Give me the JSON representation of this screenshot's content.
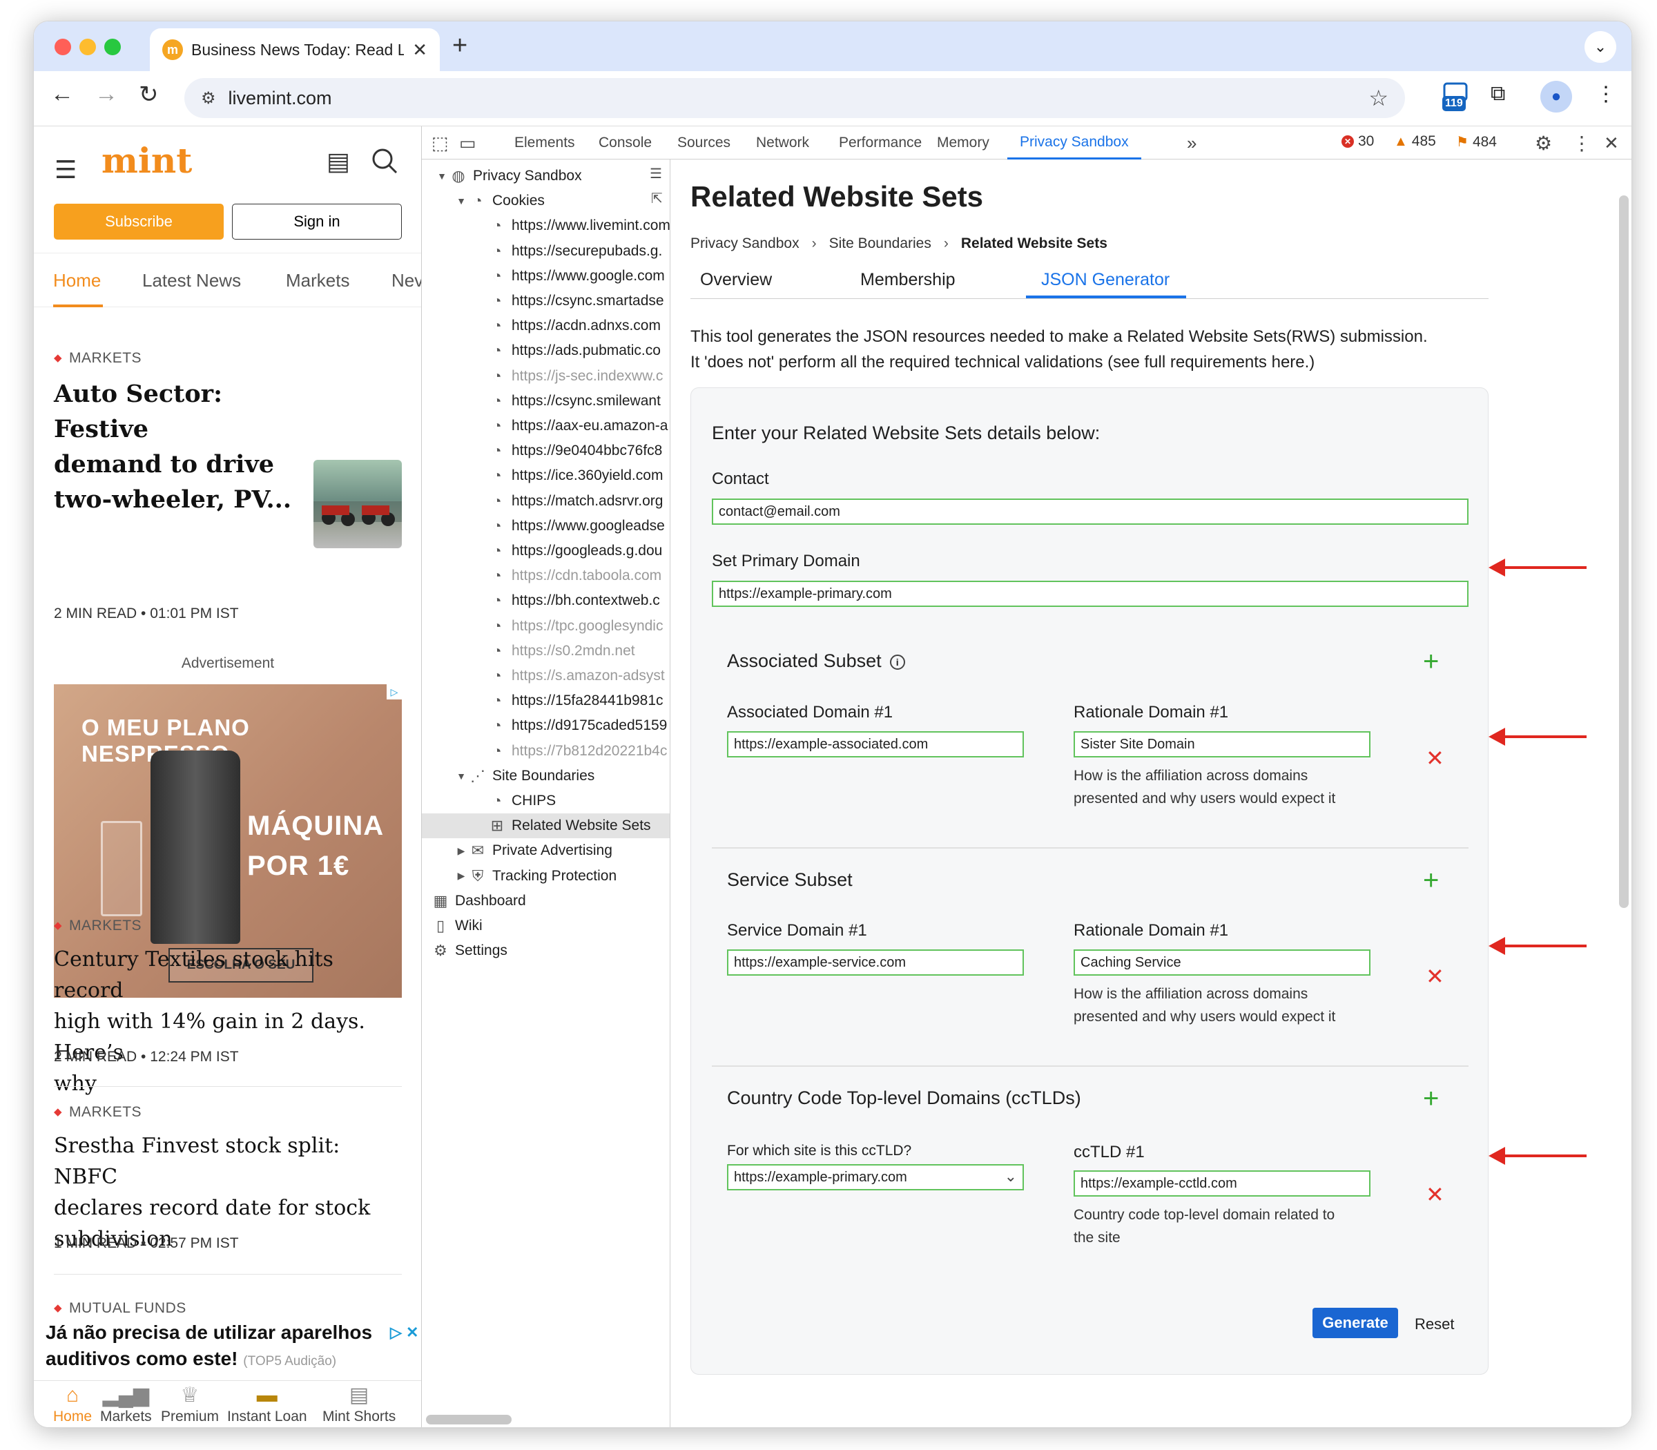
{
  "browser": {
    "tab_title": "Business News Today: Read L",
    "favicon_letter": "m",
    "url": "livemint.com",
    "extension_badge": "119"
  },
  "mint": {
    "logo": "mint",
    "subscribe": "Subscribe",
    "sign_in": "Sign in",
    "nav": [
      "Home",
      "Latest News",
      "Markets",
      "Nev"
    ],
    "articles": [
      {
        "section": "MARKETS",
        "headline_lines": [
          "Auto Sector: Festive",
          "demand to drive",
          "two-wheeler, PV..."
        ],
        "meta": "2 MIN READ • 01:01 PM IST"
      },
      {
        "section": "MARKETS",
        "headline_lines": [
          "Century Textiles stock hits record",
          "high with 14% gain in 2 days. Here’s",
          "why"
        ],
        "meta": "2 MIN READ • 12:24 PM IST"
      },
      {
        "section": "MARKETS",
        "headline_lines": [
          "Srestha Finvest stock split: NBFC",
          "declares record date for stock",
          "subdivision"
        ],
        "meta": "1 MIN READ • 02:57 PM IST"
      },
      {
        "section": "MUTUAL FUNDS"
      }
    ],
    "advertisement_label": "Advertisement",
    "ad": {
      "headline": "O MEU PLANO NESPRESSO",
      "offer_line1": "MÁQUINA",
      "offer_line2": "POR 1€",
      "cta": "ESCOLHA O SEU"
    },
    "banner": {
      "line1": "Já não precisa de utilizar aparelhos",
      "line2": "auditivos como este!",
      "source": "(TOP5 Audição)"
    },
    "bottom_nav": [
      "Home",
      "Markets",
      "Premium",
      "Instant Loan",
      "Mint Shorts"
    ]
  },
  "devtools": {
    "tabs": [
      "Elements",
      "Console",
      "Sources",
      "Network",
      "Performance",
      "Memory",
      "Privacy Sandbox"
    ],
    "active_tab": "Privacy Sandbox",
    "counts": {
      "errors": "30",
      "warnings": "485",
      "issues": "484"
    },
    "tree": {
      "root": "Privacy Sandbox",
      "cookies": "Cookies",
      "cookie_items": [
        {
          "url": "https://www.livemint.com",
          "dim": false
        },
        {
          "url": "https://securepubads.g.",
          "dim": false
        },
        {
          "url": "https://www.google.com",
          "dim": false
        },
        {
          "url": "https://csync.smartadse",
          "dim": false
        },
        {
          "url": "https://acdn.adnxs.com",
          "dim": false
        },
        {
          "url": "https://ads.pubmatic.co",
          "dim": false
        },
        {
          "url": "https://js-sec.indexww.c",
          "dim": true
        },
        {
          "url": "https://csync.smilewant",
          "dim": false
        },
        {
          "url": "https://aax-eu.amazon-a",
          "dim": false
        },
        {
          "url": "https://9e0404bbc76fc8",
          "dim": false
        },
        {
          "url": "https://ice.360yield.com",
          "dim": false
        },
        {
          "url": "https://match.adsrvr.org",
          "dim": false
        },
        {
          "url": "https://www.googleadse",
          "dim": false
        },
        {
          "url": "https://googleads.g.dou",
          "dim": false
        },
        {
          "url": "https://cdn.taboola.com",
          "dim": true
        },
        {
          "url": "https://bh.contextweb.c",
          "dim": false
        },
        {
          "url": "https://tpc.googlesyndic",
          "dim": true
        },
        {
          "url": "https://s0.2mdn.net",
          "dim": true
        },
        {
          "url": "https://s.amazon-adsyst",
          "dim": true
        },
        {
          "url": "https://15fa28441b981c",
          "dim": false
        },
        {
          "url": "https://d9175caded5159",
          "dim": false
        },
        {
          "url": "https://7b812d20221b4c",
          "dim": true
        }
      ],
      "site_boundaries": "Site Boundaries",
      "chips": "CHIPS",
      "rws": "Related Website Sets",
      "private_advertising": "Private Advertising",
      "tracking_protection": "Tracking Protection",
      "dashboard": "Dashboard",
      "wiki": "Wiki",
      "settings": "Settings"
    },
    "panel": {
      "title": "Related Website Sets",
      "breadcrumb": [
        "Privacy Sandbox",
        "Site Boundaries",
        "Related Website Sets"
      ],
      "tabs": [
        "Overview",
        "Membership",
        "JSON Generator"
      ],
      "active_tab": "JSON Generator",
      "description_line1": "This tool generates the JSON resources needed to make a Related Website Sets(RWS) submission.",
      "description_line2": "It 'does not' perform all the required technical validations (see full requirements here.)",
      "form": {
        "heading": "Enter your Related Website Sets details below:",
        "contact_label": "Contact",
        "contact_value": "contact@email.com",
        "primary_label": "Set Primary Domain",
        "primary_value": "https://example-primary.com",
        "associated": {
          "title": "Associated Subset",
          "domain_label": "Associated Domain #1",
          "domain_value": "https://example-associated.com",
          "rationale_label": "Rationale Domain #1",
          "rationale_value": "Sister Site Domain",
          "help_line1": "How is the affiliation across domains",
          "help_line2": "presented and why users would expect it"
        },
        "service": {
          "title": "Service Subset",
          "domain_label": "Service Domain #1",
          "domain_value": "https://example-service.com",
          "rationale_label": "Rationale Domain #1",
          "rationale_value": "Caching Service",
          "help_line1": "How is the affiliation across domains",
          "help_line2": "presented and why users would expect it"
        },
        "cctld": {
          "title": "Country Code Top-level Domains (ccTLDs)",
          "site_label": "For which site is this ccTLD?",
          "site_value": "https://example-primary.com",
          "cctld_label": "ccTLD #1",
          "cctld_value": "https://example-cctld.com",
          "help_line1": "Country code top-level domain related to",
          "help_line2": "the site"
        },
        "generate": "Generate",
        "reset": "Reset"
      }
    }
  },
  "colors": {
    "mint_orange": "#f28c1d",
    "devtools_blue": "#1a73e8",
    "valid_green": "#61c35c",
    "annotation_red": "#e0271f"
  }
}
